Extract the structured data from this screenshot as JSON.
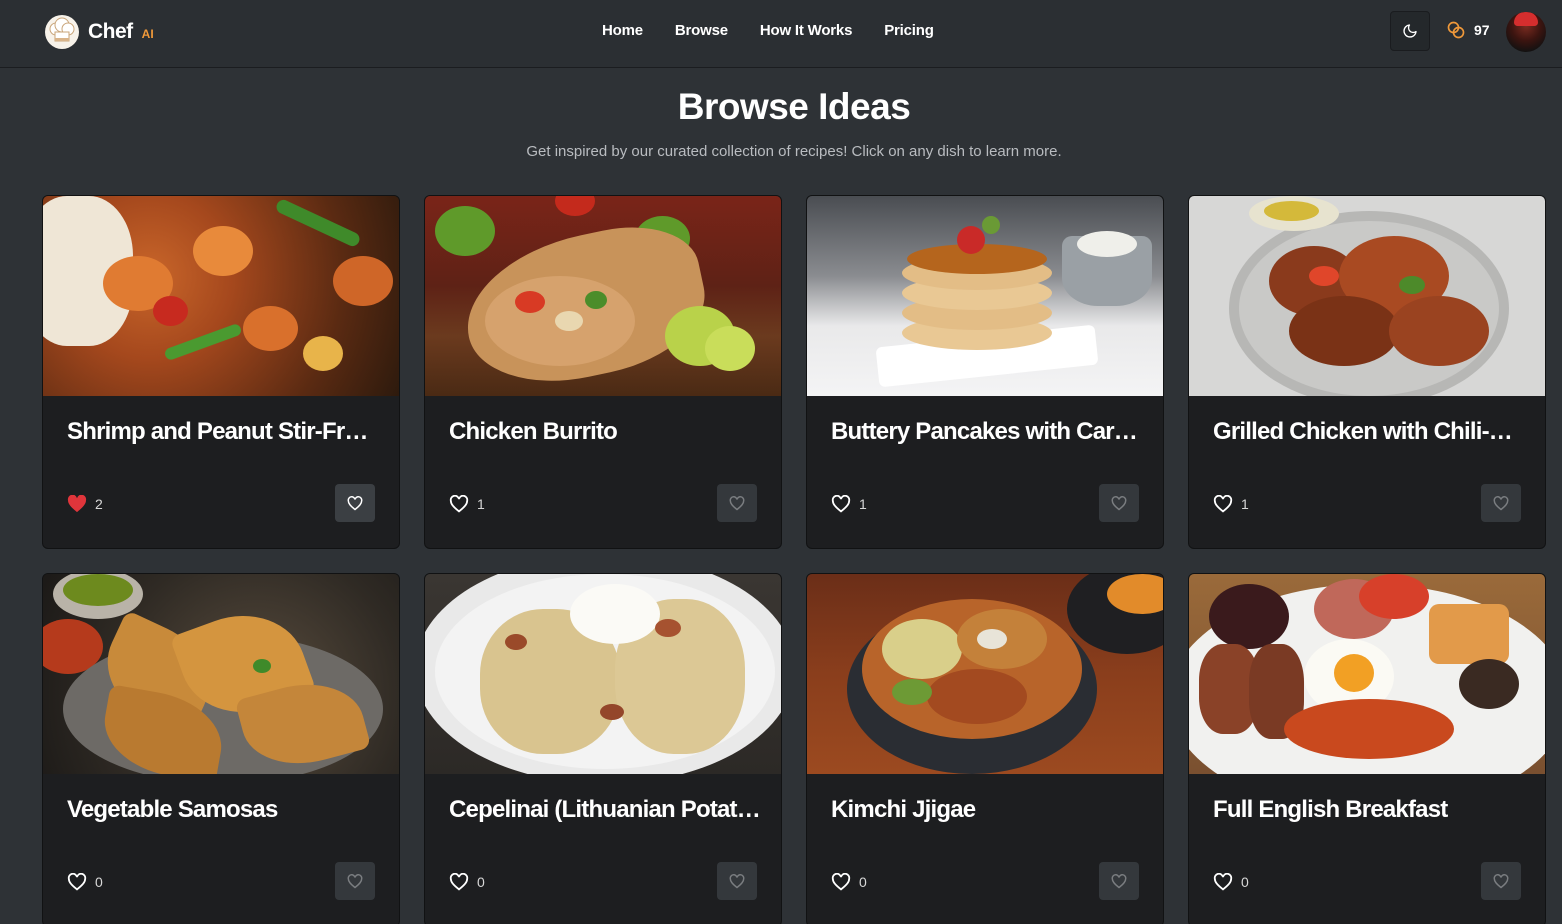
{
  "header": {
    "brand": "Chef",
    "brand_suffix": "AI",
    "nav": [
      "Home",
      "Browse",
      "How It Works",
      "Pricing"
    ],
    "credits": "97"
  },
  "page": {
    "title": "Browse Ideas",
    "subtitle": "Get inspired by our curated collection of recipes! Click on any dish to learn more."
  },
  "recipes": [
    {
      "title": "Shrimp and Peanut Stir-Fry with Vegetables",
      "likes": "2",
      "liked": true
    },
    {
      "title": "Chicken Burrito",
      "likes": "1",
      "liked": false
    },
    {
      "title": "Buttery Pancakes with Caramel Sauce",
      "likes": "1",
      "liked": false
    },
    {
      "title": "Grilled Chicken with Chili-Lime Sauce",
      "likes": "1",
      "liked": false
    },
    {
      "title": "Vegetable Samosas",
      "likes": "0",
      "liked": false
    },
    {
      "title": "Cepelinai (Lithuanian Potato Dumplings)",
      "likes": "0",
      "liked": false
    },
    {
      "title": "Kimchi Jjigae",
      "likes": "0",
      "liked": false
    },
    {
      "title": "Full English Breakfast",
      "likes": "0",
      "liked": false
    }
  ],
  "colors": {
    "background": "#2e3236",
    "card": "#1d1e20",
    "accent": "#f0993a",
    "liked_heart": "#e0353b"
  }
}
